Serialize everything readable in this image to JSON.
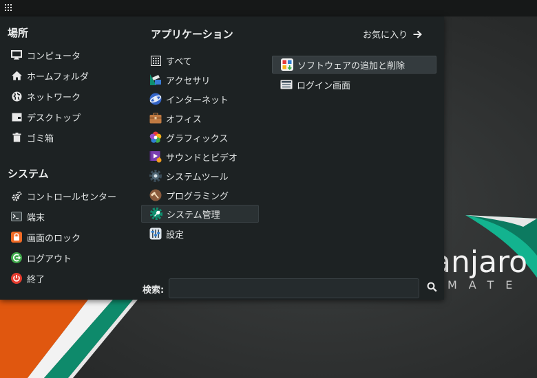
{
  "panel": {
    "apps_button_icon": "grid-icon"
  },
  "desktop": {
    "logo_text": "anjaro",
    "logo_sub": "MATE",
    "colors": {
      "orange": "#e0570f",
      "green": "#0e8a6b",
      "teal": "#13b38f"
    }
  },
  "menu": {
    "places": {
      "heading": "場所",
      "items": [
        {
          "label": "コンピュータ",
          "icon": "monitor-icon"
        },
        {
          "label": "ホームフォルダ",
          "icon": "home-icon"
        },
        {
          "label": "ネットワーク",
          "icon": "globe-icon"
        },
        {
          "label": "デスクトップ",
          "icon": "desktop-icon"
        },
        {
          "label": "ゴミ箱",
          "icon": "trash-icon"
        }
      ]
    },
    "system": {
      "heading": "システム",
      "items": [
        {
          "label": "コントロールセンター",
          "icon": "gears-icon"
        },
        {
          "label": "端末",
          "icon": "terminal-icon"
        },
        {
          "label": "画面のロック",
          "icon": "lock-icon"
        },
        {
          "label": "ログアウト",
          "icon": "logout-icon"
        },
        {
          "label": "終了",
          "icon": "power-icon"
        }
      ]
    },
    "applications": {
      "heading": "アプリケーション",
      "favorites_label": "お気に入り",
      "categories": [
        {
          "label": "すべて",
          "icon": "all-apps-icon"
        },
        {
          "label": "アクセサリ",
          "icon": "accessories-icon"
        },
        {
          "label": "インターネット",
          "icon": "internet-icon"
        },
        {
          "label": "オフィス",
          "icon": "office-briefcase-icon"
        },
        {
          "label": "グラフィックス",
          "icon": "graphics-icon"
        },
        {
          "label": "サウンドとビデオ",
          "icon": "multimedia-icon"
        },
        {
          "label": "システムツール",
          "icon": "system-tools-icon"
        },
        {
          "label": "プログラミング",
          "icon": "programming-icon"
        },
        {
          "label": "システム管理",
          "icon": "administration-icon",
          "selected": true
        },
        {
          "label": "設定",
          "icon": "settings-icon"
        }
      ],
      "apps": [
        {
          "label": "ソフトウェアの追加と削除",
          "icon": "software-install-icon",
          "highlighted": true
        },
        {
          "label": "ログイン画面",
          "icon": "login-screen-icon"
        }
      ]
    },
    "search": {
      "label": "検索:",
      "value": "",
      "placeholder": ""
    }
  }
}
